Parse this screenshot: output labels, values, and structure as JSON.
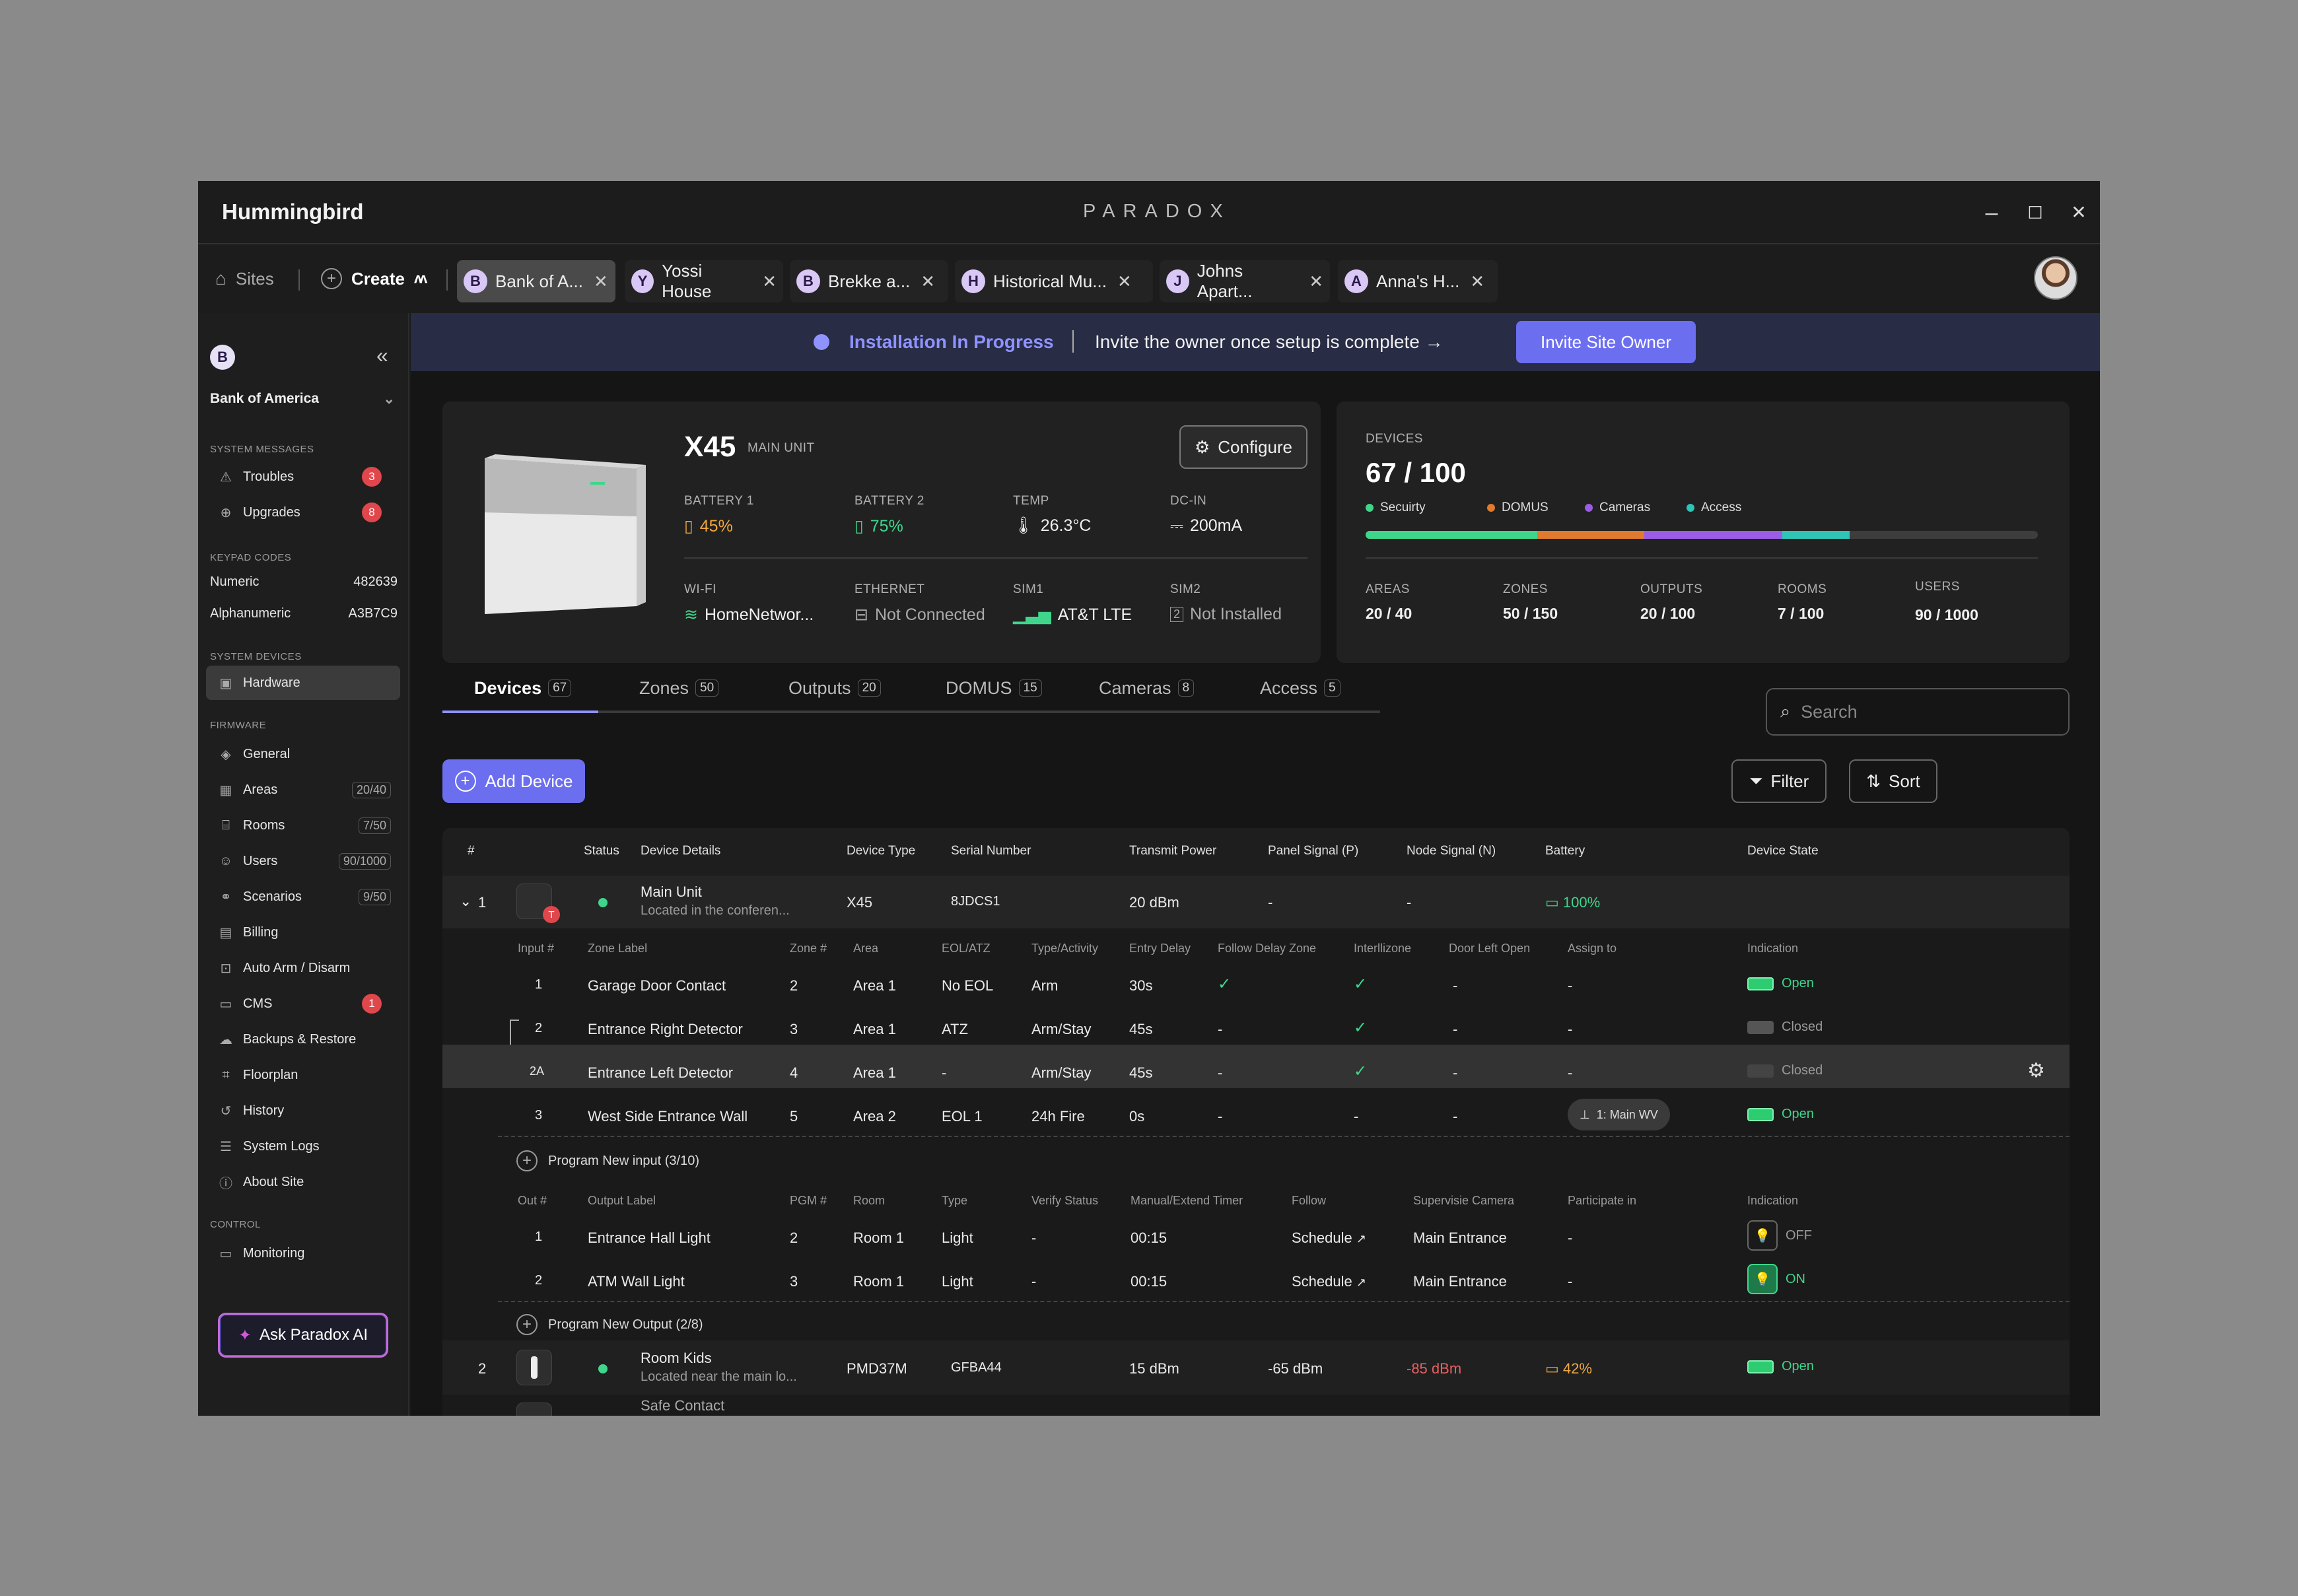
{
  "window": {
    "title": "Hummingbird",
    "brand": "PARADOX",
    "controls": {
      "minimize": "–",
      "maximize": "☐",
      "close": "✕"
    }
  },
  "nav": {
    "sites_label": "Sites",
    "create_label": "Create"
  },
  "site_tabs": [
    {
      "initial": "B",
      "label": "Bank of A...",
      "active": true
    },
    {
      "initial": "Y",
      "label": "Yossi House",
      "active": false
    },
    {
      "initial": "B",
      "label": "Brekke a...",
      "active": false
    },
    {
      "initial": "H",
      "label": "Historical Mu...",
      "active": false
    },
    {
      "initial": "J",
      "label": "Johns Apart...",
      "active": false
    },
    {
      "initial": "A",
      "label": "Anna's H...",
      "active": false
    }
  ],
  "sidebar": {
    "site_initial": "B",
    "site_name": "Bank of America",
    "sections": {
      "system_messages": "SYSTEM MESSAGES",
      "keypad_codes": "KEYPAD CODES",
      "system_devices": "SYSTEM DEVICES",
      "firmware": "FIRMWARE",
      "control": "CONTROL"
    },
    "messages": [
      {
        "label": "Troubles",
        "badge": "3"
      },
      {
        "label": "Upgrades",
        "badge": "8"
      }
    ],
    "keypad": [
      {
        "label": "Numeric",
        "value": "482639"
      },
      {
        "label": "Alphanumeric",
        "value": "A3B7C9"
      }
    ],
    "hardware_label": "Hardware",
    "firmware_items": [
      {
        "label": "General",
        "count": ""
      },
      {
        "label": "Areas",
        "count": "20/40"
      },
      {
        "label": "Rooms",
        "count": "7/50"
      },
      {
        "label": "Users",
        "count": "90/1000"
      },
      {
        "label": "Scenarios",
        "count": "9/50"
      },
      {
        "label": "Billing",
        "count": ""
      },
      {
        "label": "Auto Arm / Disarm",
        "count": ""
      },
      {
        "label": "CMS",
        "badge": "1"
      },
      {
        "label": "Backups & Restore",
        "count": ""
      },
      {
        "label": "Floorplan",
        "count": ""
      },
      {
        "label": "History",
        "count": ""
      },
      {
        "label": "System Logs",
        "count": ""
      },
      {
        "label": "About Site",
        "count": ""
      }
    ],
    "monitoring_label": "Monitoring",
    "ask_label": "Ask Paradox AI"
  },
  "banner": {
    "status": "Installation In Progress",
    "message": "Invite the owner once setup is complete →",
    "button": "Invite Site Owner"
  },
  "unit": {
    "model": "X45",
    "type": "MAIN UNIT",
    "configure": "Configure",
    "battery1": {
      "label": "BATTERY 1",
      "value": "45%"
    },
    "battery2": {
      "label": "BATTERY 2",
      "value": "75%"
    },
    "temp": {
      "label": "TEMP",
      "value": "26.3°C"
    },
    "dcin": {
      "label": "DC-IN",
      "value": "200mA"
    },
    "wifi": {
      "label": "WI-FI",
      "value": "HomeNetwor..."
    },
    "ethernet": {
      "label": "ETHERNET",
      "value": "Not Connected"
    },
    "sim1": {
      "label": "SIM1",
      "value": "AT&T LTE"
    },
    "sim2": {
      "label": "SIM2",
      "value": "Not Installed"
    }
  },
  "devices_summary": {
    "label": "DEVICES",
    "value": "67 / 100",
    "legend": [
      {
        "name": "Secuirty",
        "color": "#3fd68c",
        "share": 0.255
      },
      {
        "name": "DOMUS",
        "color": "#e07a2e",
        "share": 0.16
      },
      {
        "name": "Cameras",
        "color": "#9b5de5",
        "share": 0.205
      },
      {
        "name": "Access",
        "color": "#2ec4b6",
        "share": 0.1
      }
    ],
    "stats": [
      {
        "label": "AREAS",
        "value": "20 / 40"
      },
      {
        "label": "ZONES",
        "value": "50 / 150"
      },
      {
        "label": "OUTPUTS",
        "value": "20 / 100"
      },
      {
        "label": "ROOMS",
        "value": "7 / 100"
      },
      {
        "label": "USERS",
        "value": "90 / 1000"
      }
    ]
  },
  "device_tabs": [
    {
      "label": "Devices",
      "count": "67"
    },
    {
      "label": "Zones",
      "count": "50"
    },
    {
      "label": "Outputs",
      "count": "20"
    },
    {
      "label": "DOMUS",
      "count": "15"
    },
    {
      "label": "Cameras",
      "count": "8"
    },
    {
      "label": "Access",
      "count": "5"
    }
  ],
  "search_placeholder": "Search",
  "toolbar": {
    "add": "Add Device",
    "filter": "Filter",
    "sort": "Sort"
  },
  "table": {
    "headers": [
      "#",
      "Status",
      "Device Details",
      "Device Type",
      "Serial Number",
      "Transmit Power",
      "Panel Signal (P)",
      "Node Signal (N)",
      "Battery",
      "Device State"
    ],
    "main_unit": {
      "num": "1",
      "name": "Main Unit",
      "location": "Located in the conferen...",
      "type": "X45",
      "serial": "8JDCS1",
      "power": "20 dBm",
      "panel": "-",
      "node": "-",
      "battery": "100%",
      "icon_badge": "T"
    },
    "input_headers": [
      "Input #",
      "Zone Label",
      "Zone #",
      "Area",
      "EOL/ATZ",
      "Type/Activity",
      "Entry Delay",
      "Follow Delay Zone",
      "Interllizone",
      "Door Left Open",
      "Assign to",
      "Indication"
    ],
    "inputs": [
      {
        "num": "1",
        "label": "Garage Door Contact",
        "zone": "2",
        "area": "Area 1",
        "eol": "No EOL",
        "type": "Arm",
        "delay": "30s",
        "follow": "✓",
        "inter": "✓",
        "door": "-",
        "assign": "-",
        "indication": "Open"
      },
      {
        "num": "2",
        "label": "Entrance Right Detector",
        "zone": "3",
        "area": "Area 1",
        "eol": "ATZ",
        "type": "Arm/Stay",
        "delay": "45s",
        "follow": "-",
        "inter": "✓",
        "door": "-",
        "assign": "-",
        "indication": "Closed"
      },
      {
        "num": "2A",
        "label": "Entrance Left Detector",
        "zone": "4",
        "area": "Area 1",
        "eol": "-",
        "type": "Arm/Stay",
        "delay": "45s",
        "follow": "-",
        "inter": "✓",
        "door": "-",
        "assign": "-",
        "indication": "Closed"
      },
      {
        "num": "3",
        "label": "West Side Entrance Wall",
        "zone": "5",
        "area": "Area 2",
        "eol": "EOL 1",
        "type": "24h Fire",
        "delay": "0s",
        "follow": "-",
        "inter": "-",
        "door": "-",
        "assign": "1: Main WV",
        "indication": "Open"
      }
    ],
    "program_input": "Program New input (3/10)",
    "output_headers": [
      "Out #",
      "Output Label",
      "PGM #",
      "Room",
      "Type",
      "Verify Status",
      "Manual/Extend Timer",
      "Follow",
      "Supervisie Camera",
      "Participate in",
      "Indication"
    ],
    "outputs": [
      {
        "num": "1",
        "label": "Entrance Hall Light",
        "pgm": "2",
        "room": "Room 1",
        "type": "Light",
        "verify": "-",
        "timer": "00:15",
        "follow": "Schedule",
        "camera": "Main Entrance",
        "participate": "-",
        "indication": "OFF"
      },
      {
        "num": "2",
        "label": "ATM Wall Light",
        "pgm": "3",
        "room": "Room 1",
        "type": "Light",
        "verify": "-",
        "timer": "00:15",
        "follow": "Schedule",
        "camera": "Main Entrance",
        "participate": "-",
        "indication": "ON"
      }
    ],
    "program_output": "Program New Output (2/8)",
    "row2": {
      "num": "2",
      "name": "Room Kids",
      "location": "Located near the main lo...",
      "type": "PMD37M",
      "serial": "GFBA44",
      "power": "15 dBm",
      "panel": "-65 dBm",
      "node": "-85 dBm",
      "battery": "42%",
      "state": "Open"
    },
    "row3": {
      "name": "Safe Contact"
    }
  }
}
